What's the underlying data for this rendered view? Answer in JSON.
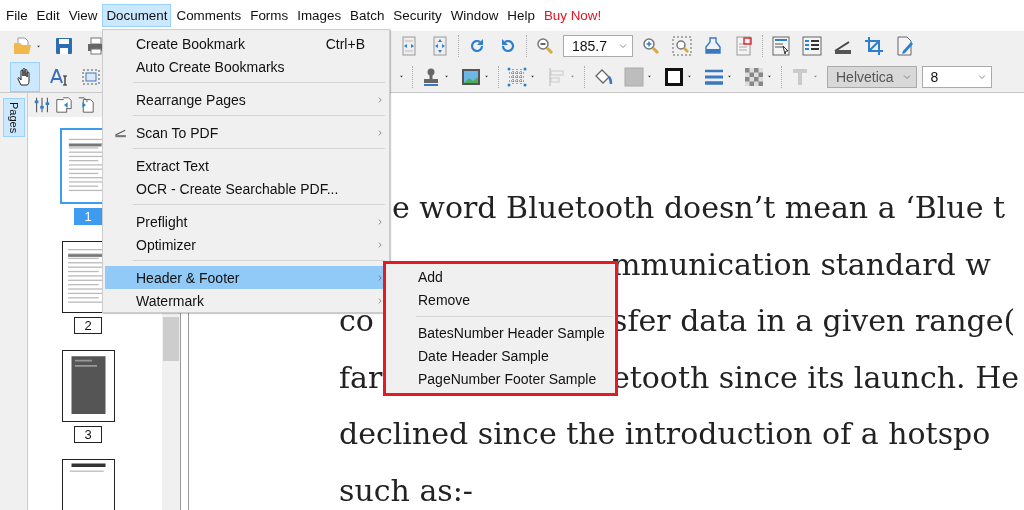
{
  "menu_bar": [
    {
      "label": "File",
      "selected": false,
      "kind": "menu"
    },
    {
      "label": "Edit",
      "selected": false,
      "kind": "menu"
    },
    {
      "label": "View",
      "selected": false,
      "kind": "menu"
    },
    {
      "label": "Document",
      "selected": true,
      "kind": "menu"
    },
    {
      "label": "Comments",
      "selected": false,
      "kind": "menu"
    },
    {
      "label": "Forms",
      "selected": false,
      "kind": "menu"
    },
    {
      "label": "Images",
      "selected": false,
      "kind": "menu"
    },
    {
      "label": "Batch",
      "selected": false,
      "kind": "menu"
    },
    {
      "label": "Security",
      "selected": false,
      "kind": "menu"
    },
    {
      "label": "Window",
      "selected": false,
      "kind": "menu"
    },
    {
      "label": "Help",
      "selected": false,
      "kind": "menu"
    },
    {
      "label": "Buy Now!",
      "selected": false,
      "kind": "promo"
    }
  ],
  "toolbar": {
    "row_1": {
      "left": [
        {
          "kind": "tool",
          "selected": false,
          "dropdown": true,
          "disabled": false
        },
        {
          "kind": "tool",
          "selected": false,
          "dropdown": false,
          "disabled": false
        },
        {
          "kind": "tool",
          "selected": false,
          "dropdown": false,
          "disabled": false
        }
      ],
      "right": [
        {
          "kind": "tool",
          "selected": false,
          "dropdown": false,
          "disabled": false
        },
        {
          "kind": "tool",
          "selected": false,
          "dropdown": false,
          "disabled": false
        },
        {
          "kind": "separator"
        },
        {
          "kind": "tool",
          "selected": false,
          "dropdown": false,
          "disabled": false
        },
        {
          "kind": "tool",
          "selected": false,
          "dropdown": false,
          "disabled": false
        },
        {
          "kind": "separator"
        },
        {
          "kind": "tool",
          "selected": false,
          "dropdown": false,
          "disabled": false
        },
        {
          "kind": "combo",
          "value": "185.7",
          "disabled": false
        },
        {
          "kind": "tool",
          "selected": false,
          "dropdown": false,
          "disabled": false
        },
        {
          "kind": "tool",
          "selected": false,
          "dropdown": false,
          "disabled": false
        },
        {
          "kind": "tool",
          "selected": false,
          "dropdown": false,
          "disabled": false
        },
        {
          "kind": "tool",
          "selected": false,
          "dropdown": false,
          "disabled": false
        },
        {
          "kind": "separator"
        },
        {
          "kind": "tool",
          "selected": false,
          "dropdown": false,
          "disabled": false
        },
        {
          "kind": "tool",
          "selected": false,
          "dropdown": false,
          "disabled": false
        },
        {
          "kind": "tool",
          "selected": false,
          "dropdown": false,
          "disabled": false
        },
        {
          "kind": "tool",
          "selected": false,
          "dropdown": false,
          "disabled": false
        },
        {
          "kind": "tool",
          "selected": false,
          "dropdown": false,
          "disabled": false
        }
      ]
    },
    "row_2": {
      "left": [
        {
          "kind": "tool",
          "selected": true,
          "dropdown": false,
          "disabled": false
        },
        {
          "kind": "tool",
          "selected": false,
          "dropdown": false,
          "disabled": false
        },
        {
          "kind": "tool",
          "selected": false,
          "dropdown": false,
          "disabled": false
        }
      ],
      "right": [
        {
          "kind": "caret"
        },
        {
          "kind": "separator"
        },
        {
          "kind": "tool",
          "selected": false,
          "dropdown": true,
          "disabled": false
        },
        {
          "kind": "tool",
          "selected": false,
          "dropdown": true,
          "disabled": false
        },
        {
          "kind": "separator"
        },
        {
          "kind": "tool",
          "selected": false,
          "dropdown": true,
          "disabled": false
        },
        {
          "kind": "tool",
          "selected": false,
          "dropdown": true,
          "disabled": true
        },
        {
          "kind": "separator"
        },
        {
          "kind": "tool",
          "selected": false,
          "dropdown": false,
          "disabled": false
        },
        {
          "kind": "tool",
          "selected": false,
          "dropdown": true,
          "disabled": false
        },
        {
          "kind": "tool",
          "selected": false,
          "dropdown": true,
          "disabled": false
        },
        {
          "kind": "tool",
          "selected": false,
          "dropdown": true,
          "disabled": false
        },
        {
          "kind": "tool",
          "selected": false,
          "dropdown": true,
          "disabled": false
        },
        {
          "kind": "separator"
        },
        {
          "kind": "tool",
          "selected": false,
          "dropdown": true,
          "disabled": true
        },
        {
          "kind": "combo",
          "value": "Helvetica",
          "disabled": true
        },
        {
          "kind": "combo",
          "value": "8",
          "disabled": false
        }
      ]
    }
  },
  "side_tabs": [
    {
      "label": "Pages",
      "selected": true
    }
  ],
  "thumbnails": [
    {
      "label": "1",
      "selected": true,
      "kind": "text"
    },
    {
      "label": "2",
      "selected": false,
      "kind": "text"
    },
    {
      "label": "3",
      "selected": false,
      "kind": "dark"
    },
    {
      "selected": false,
      "kind": "blank"
    }
  ],
  "document": {
    "lines": [
      {
        "kind": "after_menu",
        "segments": [
          "e word Bluetooth doesn’t mean a ‘Blue t"
        ]
      },
      {
        "kind": "after_submenu",
        "segments": [
          "mmunication standard w"
        ]
      },
      {
        "kind": "split",
        "segments": [
          "co",
          "sfer data in a given range("
        ]
      },
      {
        "kind": "split",
        "segments": [
          "far",
          "etooth since its launch. He"
        ]
      },
      {
        "kind": "full",
        "segments": [
          "declined since the introduction of a hotspo"
        ]
      },
      {
        "kind": "full",
        "segments": [
          "such as:-"
        ]
      }
    ]
  },
  "document_menu": {
    "items": [
      {
        "kind": "item",
        "label": "Create Bookmark",
        "shortcut": "Ctrl+B",
        "submenu": false,
        "selected": false,
        "icon": false
      },
      {
        "kind": "item",
        "label": "Auto Create Bookmarks",
        "submenu": false,
        "selected": false,
        "icon": false
      },
      {
        "kind": "separator"
      },
      {
        "kind": "item",
        "label": "Rearrange Pages",
        "submenu": true,
        "selected": false,
        "icon": false
      },
      {
        "kind": "separator"
      },
      {
        "kind": "item",
        "label": "Scan To PDF",
        "submenu": true,
        "selected": false,
        "icon": true
      },
      {
        "kind": "separator"
      },
      {
        "kind": "item",
        "label": "Extract Text",
        "submenu": false,
        "selected": false,
        "icon": false
      },
      {
        "kind": "item",
        "label": "OCR - Create Searchable PDF...",
        "submenu": false,
        "selected": false,
        "icon": false
      },
      {
        "kind": "separator"
      },
      {
        "kind": "item",
        "label": "Preflight",
        "submenu": true,
        "selected": false,
        "icon": false
      },
      {
        "kind": "item",
        "label": "Optimizer",
        "submenu": true,
        "selected": false,
        "icon": false
      },
      {
        "kind": "separator"
      },
      {
        "kind": "item",
        "label": "Header & Footer",
        "submenu": true,
        "selected": true,
        "icon": false
      },
      {
        "kind": "item",
        "label": "Watermark",
        "submenu": true,
        "selected": false,
        "icon": false
      }
    ]
  },
  "header_footer_submenu": {
    "outlined": true,
    "items": [
      {
        "kind": "item",
        "label": "Add"
      },
      {
        "kind": "item",
        "label": "Remove"
      },
      {
        "kind": "separator"
      },
      {
        "kind": "item",
        "label": "BatesNumber Header Sample"
      },
      {
        "kind": "item",
        "label": "Date Header Sample"
      },
      {
        "kind": "item",
        "label": "PageNumber Footer Sample"
      }
    ]
  }
}
